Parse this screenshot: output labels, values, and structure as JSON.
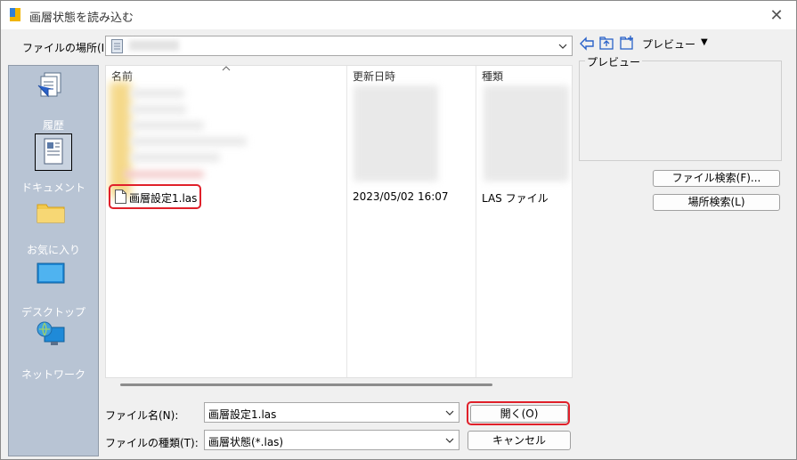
{
  "window": {
    "title": "画層状態を読み込む"
  },
  "location": {
    "label": "ファイルの場所(I):",
    "value": ""
  },
  "preview": {
    "menu_label": "プレビュー",
    "menu_arrow": "▼",
    "group_label": "プレビュー"
  },
  "places": [
    {
      "label": "履歴",
      "icon": "history-icon"
    },
    {
      "label": "ドキュメント",
      "icon": "documents-icon"
    },
    {
      "label": "お気に入り",
      "icon": "favorites-folder-icon"
    },
    {
      "label": "デスクトップ",
      "icon": "desktop-icon"
    },
    {
      "label": "ネットワーク",
      "icon": "network-icon"
    }
  ],
  "list": {
    "columns": [
      "名前",
      "更新日時",
      "種類"
    ],
    "files": [
      {
        "name": "画層設定1.las",
        "date": "2023/05/02 16:07",
        "type": "LAS ファイル"
      }
    ]
  },
  "filename": {
    "label": "ファイル名(N):",
    "value": "画層設定1.las"
  },
  "filetype": {
    "label": "ファイルの種類(T):",
    "value": "画層状態(*.las)"
  },
  "buttons": {
    "open": "開く(O)",
    "cancel": "キャンセル",
    "find_file": "ファイル検索(F)...",
    "find_location": "場所検索(L)"
  },
  "colors": {
    "highlight": "#e0202a",
    "places_bg": "#b8c4d4"
  }
}
